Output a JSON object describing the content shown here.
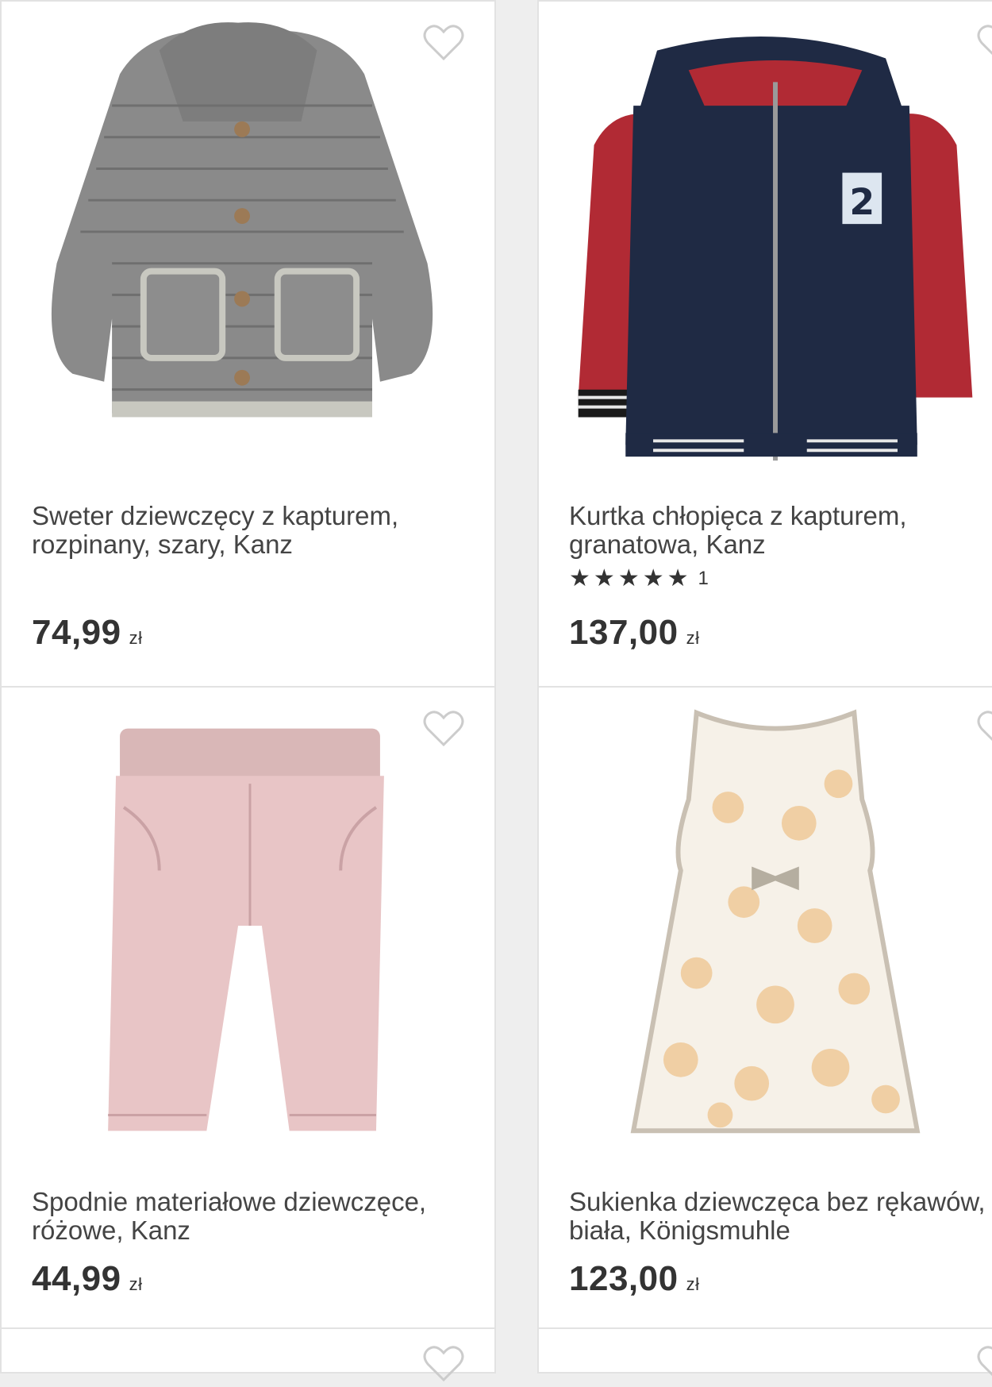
{
  "products": [
    {
      "image_alt": "grey knitted hooded cardigan",
      "title": "Sweter dziewczęcy z kapturem,\nrozpinany, szary, Kanz",
      "price": "74,99",
      "currency": "zł",
      "favorite_icon": "heart-outline-icon"
    },
    {
      "image_alt": "navy jacket with red sleeves",
      "title": "Kurtka chłopięca z kapturem,\ngranatowa, Kanz",
      "rating": {
        "stars": 5,
        "count": "1"
      },
      "price": "137,00",
      "currency": "zł",
      "favorite_icon": "heart-outline-icon"
    },
    {
      "image_alt": "pink trousers",
      "title": "Spodnie materiałowe dziewczęce,\nróżowe, Kanz",
      "price": "44,99",
      "currency": "zł",
      "favorite_icon": "heart-outline-icon"
    },
    {
      "image_alt": "white sleeveless dress with flowers",
      "title": "Sukienka dziewczęca bez rękawów,\nbiała, Königsmuhle",
      "price": "123,00",
      "currency": "zł",
      "favorite_icon": "heart-outline-icon"
    }
  ],
  "colors": {
    "background": "#eeeeee",
    "card": "#ffffff",
    "text": "#333333",
    "heart_outline": "#cccccc"
  }
}
